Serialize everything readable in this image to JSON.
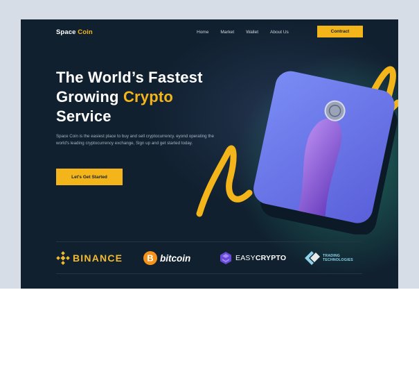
{
  "brand": {
    "name_part1": "Space",
    "name_part2": "Coin",
    "accent_color": "#f4b51a",
    "background_color": "#10202f"
  },
  "nav": {
    "items": [
      {
        "label": "Home"
      },
      {
        "label": "Market"
      },
      {
        "label": "Wallet"
      },
      {
        "label": "About Us"
      }
    ],
    "cta_label": "Contract"
  },
  "hero": {
    "title_line1": "The World’s Fastest",
    "title_line2_plain": "Growing",
    "title_line2_accent": "Crypto",
    "title_line3": "Service",
    "description": "Space Coin is the easiest place to buy and sell cryptocurrency. eyond operating the world's leading cryptocurrency exchange,  Sign up and get started today.",
    "cta_label": "Let's Get Started",
    "image_subject": "hand-holding-coin"
  },
  "partners": {
    "binance": "BINANCE",
    "bitcoin": "bitcoin",
    "easycrypto_plain": "EASY",
    "easycrypto_bold": "CRYPTO",
    "trading_line1": "TRADING",
    "trading_line2": "TECHNOLOGIES"
  }
}
